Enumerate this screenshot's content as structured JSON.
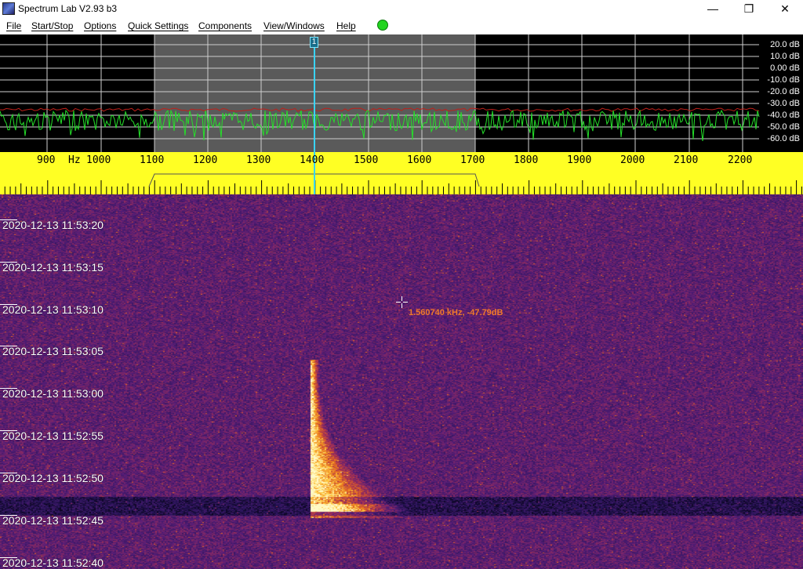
{
  "window": {
    "title": "Spectrum Lab V2.93 b3",
    "minimize_glyph": "—",
    "maximize_glyph": "❐",
    "close_glyph": "✕"
  },
  "menu": {
    "items": [
      {
        "label": "File"
      },
      {
        "label": "Start/Stop"
      },
      {
        "label": "Options"
      },
      {
        "label": "Quick Settings"
      },
      {
        "label": "Components"
      },
      {
        "label": "View/Windows"
      },
      {
        "label": "Help"
      }
    ],
    "status_led_color": "#22d41f"
  },
  "spectrum": {
    "db_labels": [
      "20.0 dB",
      "10.0 dB",
      "0.00 dB",
      "-10.0 dB",
      "-20.0 dB",
      "-30.0 dB",
      "-40.0 dB",
      "-50.0 dB",
      "-60.0 dB"
    ],
    "marker_label": "1",
    "colors": {
      "peak_trace": "#c0201a",
      "live_trace": "#25e02a",
      "passband": "#5a5a5a",
      "marker": "#39d4ff"
    }
  },
  "freq_scale": {
    "unit": "Hz",
    "labels": [
      "900",
      "1000",
      "1100",
      "1200",
      "1300",
      "1400",
      "1500",
      "1600",
      "1700",
      "1800",
      "1900",
      "2000",
      "2100",
      "2200"
    ],
    "background": "#ffff24"
  },
  "waterfall": {
    "timestamps": [
      "2020-12-13 11:53:20",
      "2020-12-13 11:53:15",
      "2020-12-13 11:53:10",
      "2020-12-13 11:53:05",
      "2020-12-13 11:53:00",
      "2020-12-13 11:52:55",
      "2020-12-13 11:52:50",
      "2020-12-13 11:52:45",
      "2020-12-13 11:52:40"
    ],
    "cursor_readout": "1.560740 kHz, -47.79dB"
  }
}
